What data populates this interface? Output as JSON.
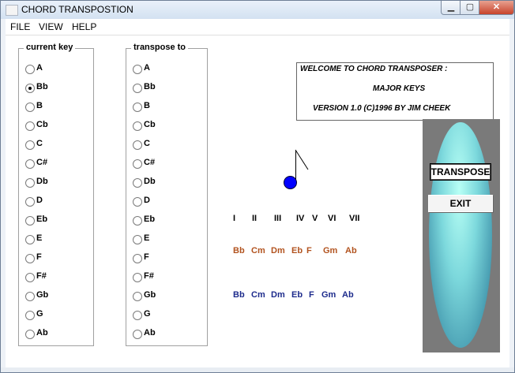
{
  "window": {
    "title": "CHORD TRANSPOSTION"
  },
  "menu": [
    "FILE",
    "VIEW",
    "HELP"
  ],
  "current_key": {
    "title": "current key",
    "keys": [
      "A",
      "Bb",
      "B",
      "Cb",
      "C",
      "C#",
      "Db",
      "D",
      "Eb",
      "E",
      "F",
      "F#",
      "Gb",
      "G",
      "Ab"
    ],
    "selected": "Bb"
  },
  "transpose_to": {
    "title": "transpose to",
    "keys": [
      "A",
      "Bb",
      "B",
      "Cb",
      "C",
      "C#",
      "Db",
      "D",
      "Eb",
      "E",
      "F",
      "F#",
      "Gb",
      "G",
      "Ab"
    ],
    "selected": ""
  },
  "welcome": {
    "line1": "WELCOME TO CHORD TRANSPOSER :",
    "line2": "MAJOR KEYS",
    "line3": "VERSION 1.0 (C)1996 BY JIM CHEEK"
  },
  "numerals": [
    "I",
    "II",
    "III",
    "IV",
    "V",
    "VI",
    "VII"
  ],
  "chords_current": [
    "Bb",
    "Cm",
    "Dm",
    "Eb",
    "F",
    "Gm",
    "Ab"
  ],
  "chords_transposed": [
    "Bb",
    "Cm",
    "Dm",
    "Eb",
    "F",
    "Gm",
    "Ab"
  ],
  "buttons": {
    "transpose": "TRANSPOSE",
    "exit": "EXIT"
  },
  "colors": {
    "chords_current": "#b2531f",
    "chords_transposed": "#1d2b8c",
    "note": "#0000ff"
  }
}
